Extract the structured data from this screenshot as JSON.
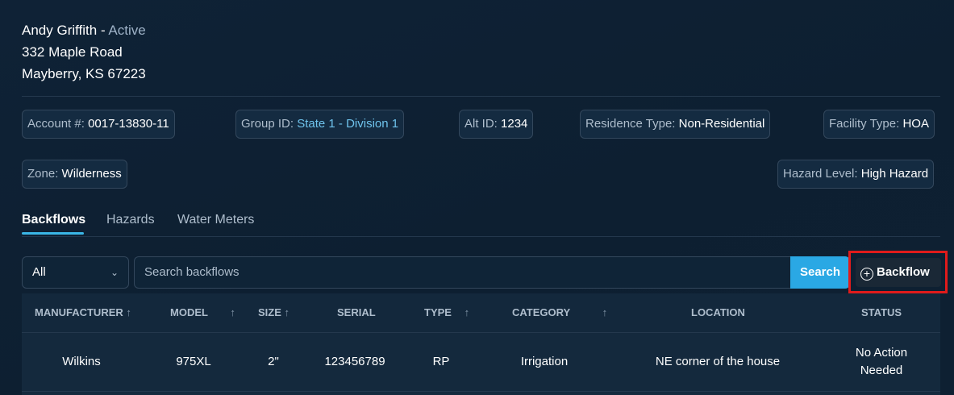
{
  "customer": {
    "name": "Andy Griffith",
    "separator": " - ",
    "status": "Active",
    "address_line1": "332 Maple Road",
    "address_line2": "Mayberry, KS 67223"
  },
  "details": {
    "account": {
      "label": "Account #:",
      "value": "0017-13830-11"
    },
    "group": {
      "label": "Group ID:",
      "value": "State 1 - Division 1"
    },
    "alt_id": {
      "label": "Alt ID:",
      "value": "1234"
    },
    "residence": {
      "label": "Residence Type:",
      "value": "Non-Residential"
    },
    "facility": {
      "label": "Facility Type:",
      "value": "HOA"
    },
    "zone": {
      "label": "Zone:",
      "value": "Wilderness"
    },
    "hazard": {
      "label": "Hazard Level:",
      "value": "High Hazard"
    }
  },
  "tabs": [
    {
      "label": "Backflows",
      "active": true
    },
    {
      "label": "Hazards",
      "active": false
    },
    {
      "label": "Water Meters",
      "active": false
    }
  ],
  "toolbar": {
    "filter_value": "All",
    "search_placeholder": "Search backflows",
    "search_label": "Search",
    "add_label": "Backflow"
  },
  "table": {
    "columns": [
      "MANUFACTURER",
      "MODEL",
      "SIZE",
      "SERIAL",
      "TYPE",
      "CATEGORY",
      "LOCATION",
      "STATUS"
    ],
    "sort_arrow": "↑",
    "rows": [
      {
        "manufacturer": "Wilkins",
        "model": "975XL",
        "size": "2\"",
        "serial": "123456789",
        "type": "RP",
        "category": "Irrigation",
        "location": "NE corner of the house",
        "status": "No Action Needed"
      }
    ]
  },
  "colors": {
    "accent": "#2aa8e4",
    "link": "#6fc3ec",
    "highlight": "#e01b1b"
  }
}
